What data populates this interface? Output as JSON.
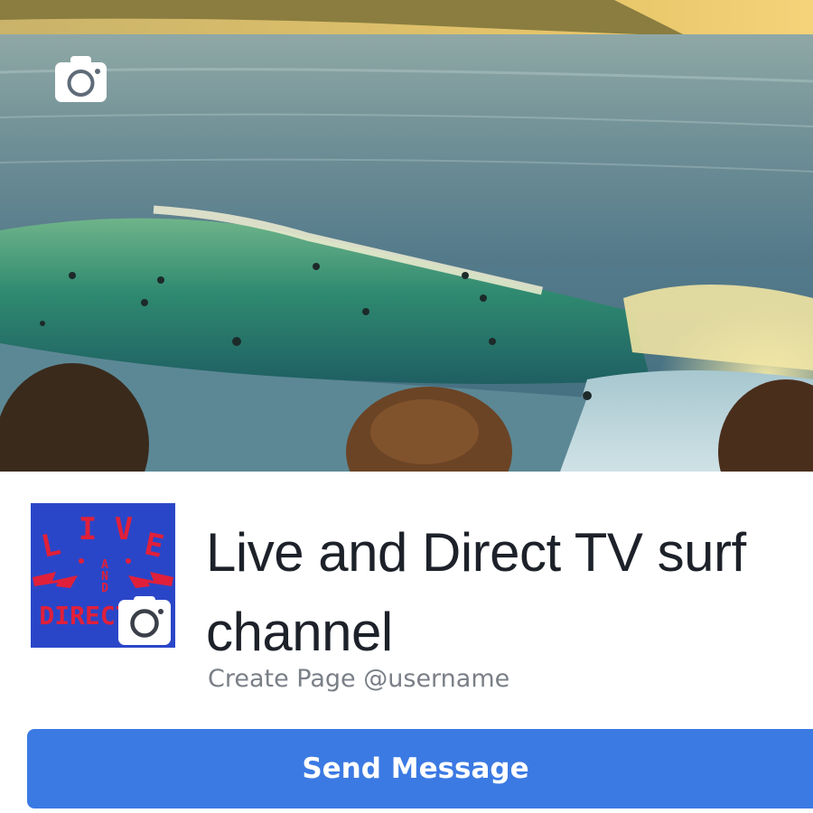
{
  "cover": {
    "image": "surf-wave-photo",
    "camera_icon": "camera-icon"
  },
  "profile": {
    "logo_text": {
      "line1": "LIVE",
      "line2": "AND",
      "line3": "DIRECT"
    },
    "camera_icon": "camera-icon"
  },
  "page": {
    "title": "Live and Direct TV surf channel",
    "create_page_label": "Create Page",
    "username_label": "@username"
  },
  "actions": {
    "send_message_label": "Send Message"
  },
  "colors": {
    "button_blue": "#3b7ae3",
    "title_text": "#1d2129",
    "sub_text": "#7a7f87",
    "logo_blue": "#2a46c8",
    "logo_red": "#e0203a"
  }
}
